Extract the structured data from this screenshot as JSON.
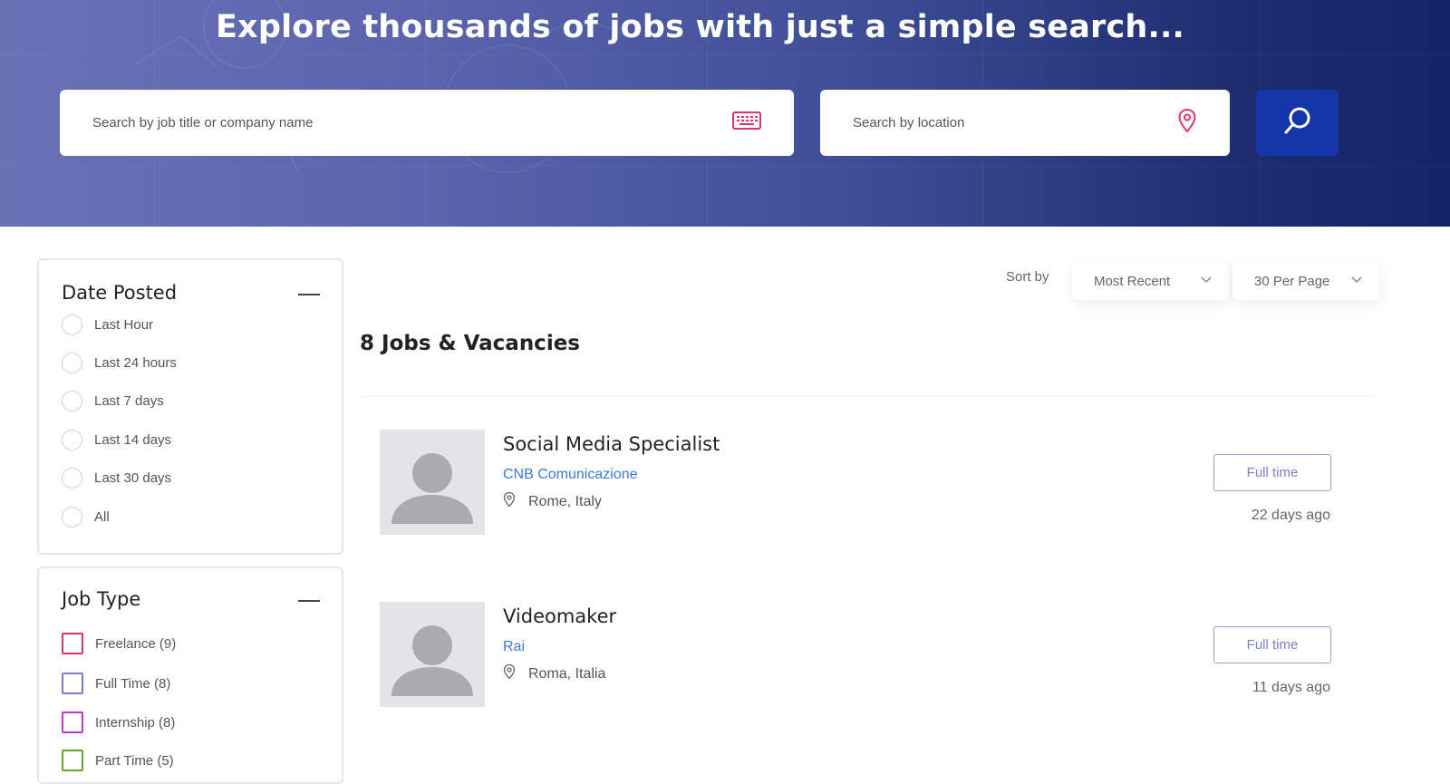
{
  "hero": {
    "title": "Explore thousands of jobs with just a simple search...",
    "keyword_placeholder": "Search by job title or company name",
    "location_placeholder": "Search by location"
  },
  "filters": {
    "date_posted": {
      "title": "Date Posted",
      "options": [
        "Last Hour",
        "Last 24 hours",
        "Last 7 days",
        "Last 14 days",
        "Last 30 days",
        "All"
      ]
    },
    "job_type": {
      "title": "Job Type",
      "options": [
        {
          "label": "Freelance (9)",
          "color": "#d6336c"
        },
        {
          "label": "Full Time (8)",
          "color": "#7a7fbf"
        },
        {
          "label": "Internship (8)",
          "color": "#c336c3"
        },
        {
          "label": "Part Time (5)",
          "color": "#5caa2c"
        }
      ]
    }
  },
  "toolbar": {
    "sort_label": "Sort by",
    "sort_value": "Most Recent",
    "per_page_value": "30 Per Page"
  },
  "results": {
    "heading": "8 Jobs & Vacancies",
    "jobs": [
      {
        "title": "Social Media Specialist",
        "company": "CNB Comunicazione",
        "location": "Rome, Italy",
        "type": "Full time",
        "posted": "22 days ago"
      },
      {
        "title": "Videomaker",
        "company": "Rai",
        "location": "Roma, Italia",
        "type": "Full time",
        "posted": "11 days ago"
      }
    ]
  },
  "colors": {
    "accent_blue": "#1436a8",
    "icon_pink": "#e0306d",
    "link_blue": "#3a7bd5"
  }
}
